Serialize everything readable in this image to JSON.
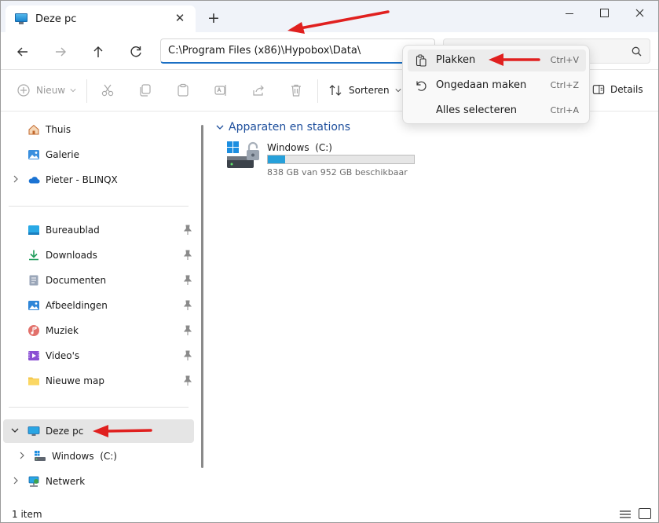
{
  "window": {
    "tab_title": "Deze pc",
    "close_tab_glyph": "✕",
    "new_tab_glyph": "+"
  },
  "address_bar": {
    "path": "C:\\Program Files (x86)\\Hypobox\\Data\\"
  },
  "toolbar": {
    "new_label": "Nieuw",
    "sort_label": "Sorteren",
    "details_label": "Details"
  },
  "sidebar": {
    "quick": [
      {
        "label": "Thuis",
        "icon": "home-icon"
      },
      {
        "label": "Galerie",
        "icon": "gallery-icon"
      },
      {
        "label": "Pieter - BLINQX",
        "icon": "onedrive-icon"
      }
    ],
    "pinned": [
      {
        "label": "Bureaublad",
        "icon": "desktop-icon"
      },
      {
        "label": "Downloads",
        "icon": "downloads-icon"
      },
      {
        "label": "Documenten",
        "icon": "documents-icon"
      },
      {
        "label": "Afbeeldingen",
        "icon": "pictures-icon"
      },
      {
        "label": "Muziek",
        "icon": "music-icon"
      },
      {
        "label": "Video's",
        "icon": "videos-icon"
      },
      {
        "label": "Nieuwe map",
        "icon": "folder-icon"
      }
    ],
    "tree": [
      {
        "label": "Deze pc",
        "icon": "this-pc-icon"
      },
      {
        "label": "Windows  (C:)",
        "icon": "drive-icon"
      },
      {
        "label": "Netwerk",
        "icon": "network-icon"
      }
    ]
  },
  "content": {
    "section_title": "Apparaten en stations",
    "drive": {
      "name": "Windows  (C:)",
      "free_text": "838 GB van 952 GB beschikbaar",
      "used_fraction": 0.12
    }
  },
  "context_menu": {
    "items": [
      {
        "label": "Plakken",
        "shortcut": "Ctrl+V",
        "icon": "paste-icon"
      },
      {
        "label": "Ongedaan maken",
        "shortcut": "Ctrl+Z",
        "icon": "undo-icon"
      },
      {
        "label": "Alles selecteren",
        "shortcut": "Ctrl+A",
        "icon": ""
      }
    ]
  },
  "status": {
    "item_count": "1 item"
  },
  "colors": {
    "accent": "#1a6fc4",
    "section_title": "#1d4e9c",
    "drive_fill": "#26a0da",
    "annotation_arrow": "#e0201f"
  }
}
